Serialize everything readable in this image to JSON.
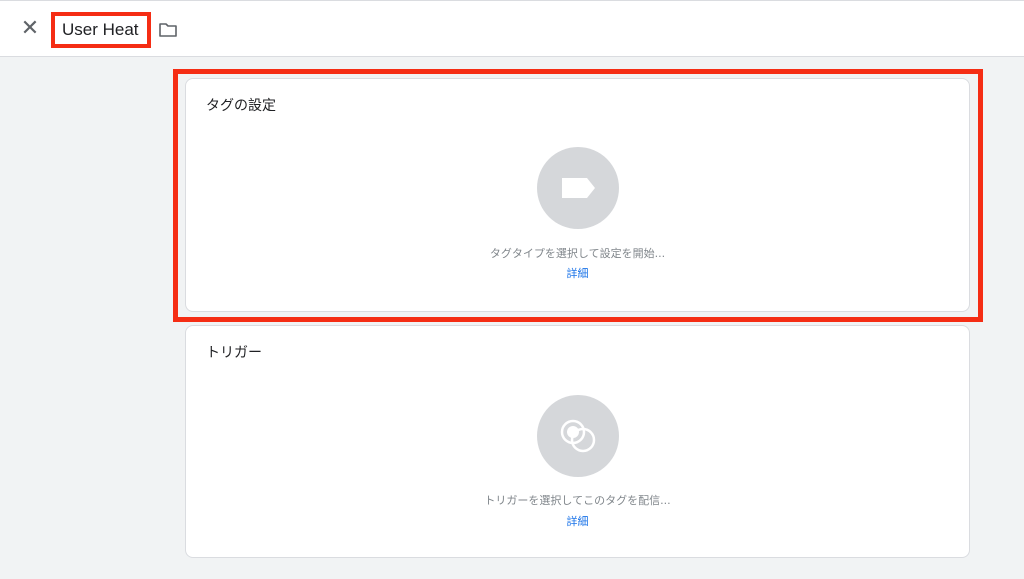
{
  "header": {
    "close_glyph": "✕",
    "title": "User Heat"
  },
  "tag_card": {
    "title": "タグの設定",
    "hint": "タグタイプを選択して設定を開始...",
    "link": "詳細",
    "icon": "tag-icon"
  },
  "trigger_card": {
    "title": "トリガー",
    "hint": "トリガーを選択してこのタグを配信...",
    "link": "詳細",
    "icon": "trigger-icon"
  },
  "colors": {
    "highlight": "#f52d14",
    "link": "#1a73e8",
    "icon_circle": "#d5d7da"
  }
}
